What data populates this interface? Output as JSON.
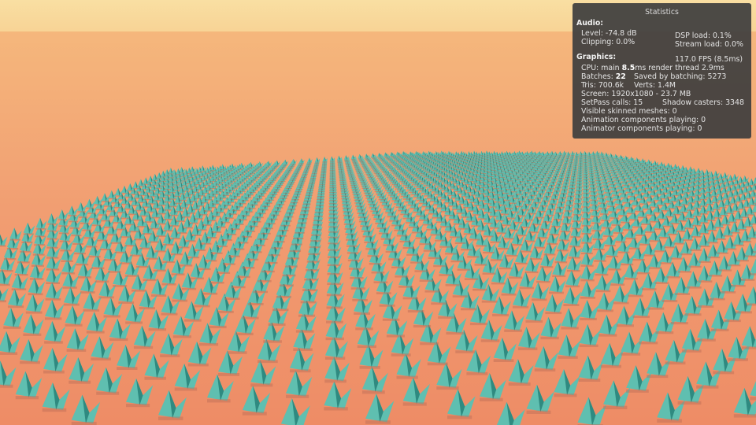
{
  "stats": {
    "title": "Statistics",
    "audio_header": "Audio:",
    "level": "Level: -74.8 dB",
    "dsp_load": "DSP load: 0.1%",
    "clipping": "Clipping: 0.0%",
    "stream_load": "Stream load: 0.0%",
    "graphics_header": "Graphics:",
    "fps": "117.0 FPS (8.5ms)",
    "cpu_prefix": "CPU: main ",
    "cpu_main": "8.5",
    "cpu_suffix": "ms  render thread 2.9ms",
    "batches_prefix": "Batches: ",
    "batches": "22",
    "saved_batching": "Saved by batching: 5273",
    "tris": "Tris: 700.6k",
    "verts": "Verts: 1.4M",
    "screen": "Screen: 1920x1080 - 23.7 MB",
    "setpass": "SetPass calls: 15",
    "shadow_casters": "Shadow casters: 3348",
    "skinned_meshes": "Visible skinned meshes: 0",
    "animation_components": "Animation components playing: 0",
    "animator_components": "Animator components playing: 0"
  },
  "scene": {
    "sky_color": "#f9dc98",
    "ground_near_color": "#f08a68",
    "ground_far_color": "#f4b27a",
    "unit_color": "#5fbfb0",
    "unit_shade_color": "#2f8a80"
  }
}
